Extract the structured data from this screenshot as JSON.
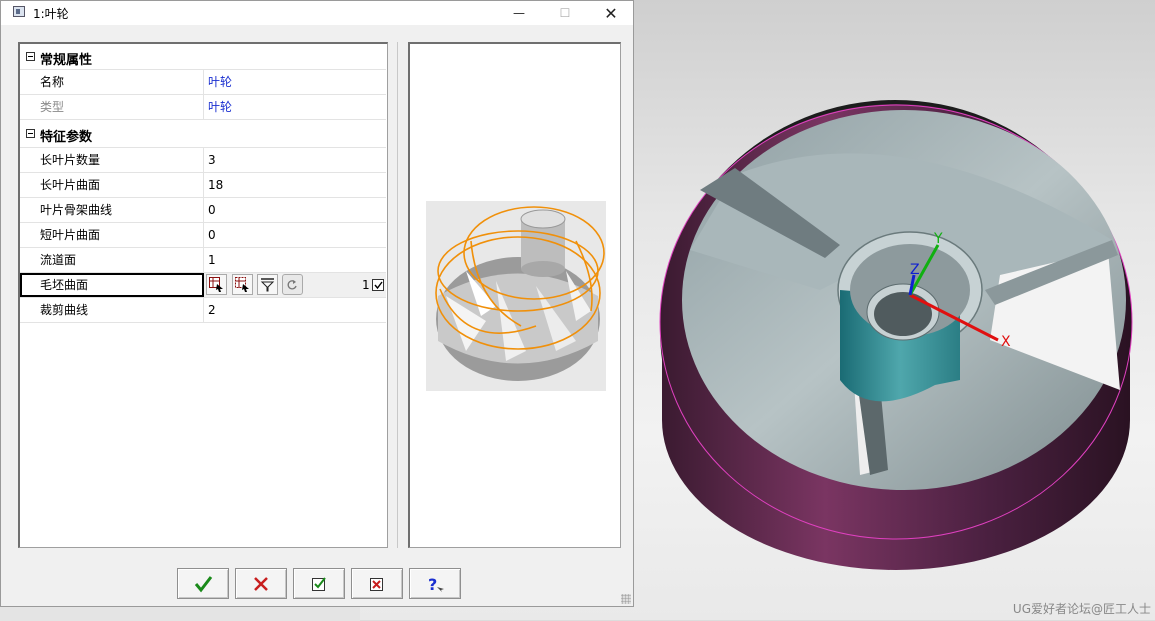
{
  "dialog": {
    "title": "1:叶轮",
    "icons": {
      "window": "window-icon",
      "minimize": "minimize-icon",
      "maximize": "maximize-icon",
      "close": "close-icon"
    },
    "min_glyph": "—",
    "max_glyph": "☐",
    "close_glyph": "✕"
  },
  "sections": [
    {
      "title": "常规属性",
      "rows": [
        {
          "name": "名称",
          "value": "叶轮"
        },
        {
          "name": "类型",
          "value": "叶轮"
        }
      ]
    },
    {
      "title": "特征参数",
      "rows": [
        {
          "name": "长叶片数量",
          "value": "3"
        },
        {
          "name": "长叶片曲面",
          "value": "18"
        },
        {
          "name": "叶片骨架曲线",
          "value": "0"
        },
        {
          "name": "短叶片曲面",
          "value": "0"
        },
        {
          "name": "流道面",
          "value": "1"
        },
        {
          "name": "毛坯曲面",
          "value": "",
          "count": "1",
          "checked": true
        },
        {
          "name": "裁剪曲线",
          "value": "2"
        }
      ]
    }
  ],
  "row_tools": [
    "select-pick-icon",
    "select-multi-icon",
    "filter-icon",
    "reset-icon"
  ],
  "buttons": [
    {
      "name": "ok-button",
      "icon": "green-check-icon"
    },
    {
      "name": "cancel-button",
      "icon": "red-x-icon"
    },
    {
      "name": "apply-button",
      "icon": "checked-box-icon"
    },
    {
      "name": "clear-button",
      "icon": "crossed-box-icon"
    },
    {
      "name": "help-button",
      "icon": "help-icon"
    }
  ],
  "colors": {
    "link_value": "#1a2fd0",
    "ok_check": "#1a8a1a",
    "cancel_x": "#c81e1e",
    "model_rim": "#5a2446",
    "model_edge": "#e040c0",
    "axis_x": "#e01010",
    "axis_y": "#10b010",
    "axis_z": "#1020d0",
    "preview_highlight": "#f0900a"
  },
  "viewport": {
    "axes": {
      "x": "X",
      "y": "Y",
      "z": "Z"
    },
    "watermark": "UG爱好者论坛@匠工人士"
  }
}
